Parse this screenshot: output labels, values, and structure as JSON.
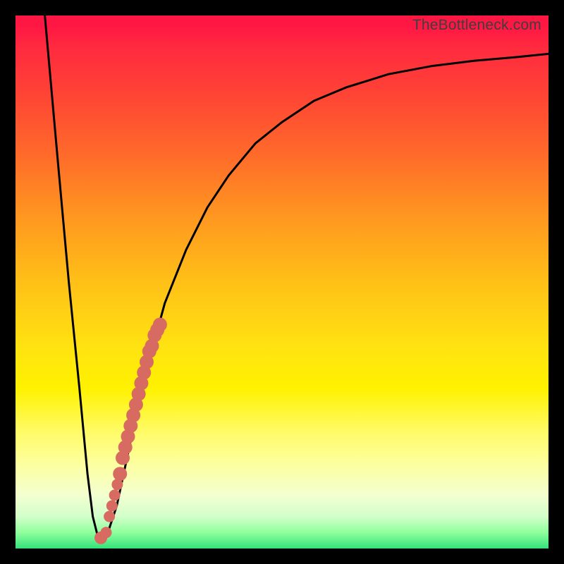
{
  "watermark": "TheBottleneck.com",
  "chart_data": {
    "type": "line",
    "title": "",
    "xlabel": "",
    "ylabel": "",
    "xlim": [
      0,
      100
    ],
    "ylim": [
      0,
      100
    ],
    "grid": false,
    "legend": false,
    "notes": "No axes, ticks, or labels are shown. x/y are normalized 0–100 across the visible plot area; y=100 is top.",
    "series": [
      {
        "name": "black-curve",
        "color": "#000000",
        "x": [
          5.5,
          8,
          10,
          12,
          13.5,
          14.5,
          15.5,
          17,
          19,
          22,
          25,
          28,
          32,
          36,
          40,
          45,
          50,
          56,
          62,
          70,
          78,
          86,
          94,
          100
        ],
        "y": [
          100,
          72,
          50,
          30,
          14,
          6,
          2,
          2,
          8,
          22,
          35,
          46,
          56,
          64,
          70,
          76,
          80,
          84,
          86.5,
          89,
          90.5,
          91.5,
          92.2,
          92.8
        ]
      },
      {
        "name": "salmon-points",
        "type": "scatter",
        "color": "#d76b61",
        "x": [
          16.0,
          17.0,
          17.6,
          18.1,
          18.6,
          19.1,
          19.6,
          20.1,
          20.6,
          21.1,
          21.6,
          22.1,
          22.6,
          23.1,
          23.6,
          24.1,
          24.6,
          25.1,
          25.6,
          26.1,
          26.6,
          27.1
        ],
        "y": [
          2,
          3,
          6,
          8,
          10,
          12,
          14,
          17,
          19,
          21,
          23,
          25,
          27,
          29,
          31,
          33,
          35,
          37,
          38,
          40,
          41,
          42
        ],
        "radius_px": [
          9,
          8,
          8,
          8,
          8,
          8,
          10,
          10,
          10,
          10,
          10,
          10,
          10,
          10,
          10,
          10,
          10,
          10,
          10,
          10,
          10,
          10
        ]
      }
    ],
    "background_gradient": {
      "direction": "top-to-bottom",
      "stops": [
        {
          "pos": 0.0,
          "color": "#ff1744"
        },
        {
          "pos": 0.14,
          "color": "#ff4136"
        },
        {
          "pos": 0.38,
          "color": "#ff9820"
        },
        {
          "pos": 0.62,
          "color": "#ffe211"
        },
        {
          "pos": 0.84,
          "color": "#fdff9e"
        },
        {
          "pos": 0.97,
          "color": "#8fff9d"
        },
        {
          "pos": 1.0,
          "color": "#34e27a"
        }
      ]
    }
  }
}
